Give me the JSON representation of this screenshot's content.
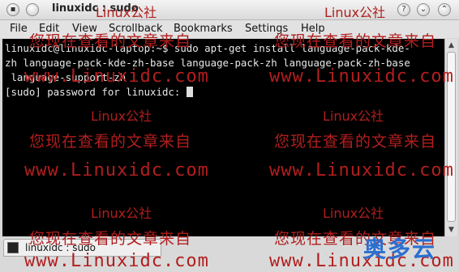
{
  "window": {
    "title": "linuxidc : sudo"
  },
  "menu": [
    "File",
    "Edit",
    "View",
    "Scrollback",
    "Bookmarks",
    "Settings",
    "Help"
  ],
  "terminal": {
    "lines": [
      "linuxidc@linuxidc-laptop:~$ sudo apt-get install language-pack-kde-",
      "zh language-pack-kde-zh-base language-pack-zh language-pack-zh-base",
      " language-support-zh",
      "[sudo] password for linuxidc: "
    ]
  },
  "tab": {
    "label": "linuxidc : sudo"
  },
  "watermark": {
    "brand": "Linux公社",
    "notice": "您现在查看的文章来自",
    "site": "www.Linuxidc.com"
  },
  "logo": {
    "text": "奥多云"
  }
}
